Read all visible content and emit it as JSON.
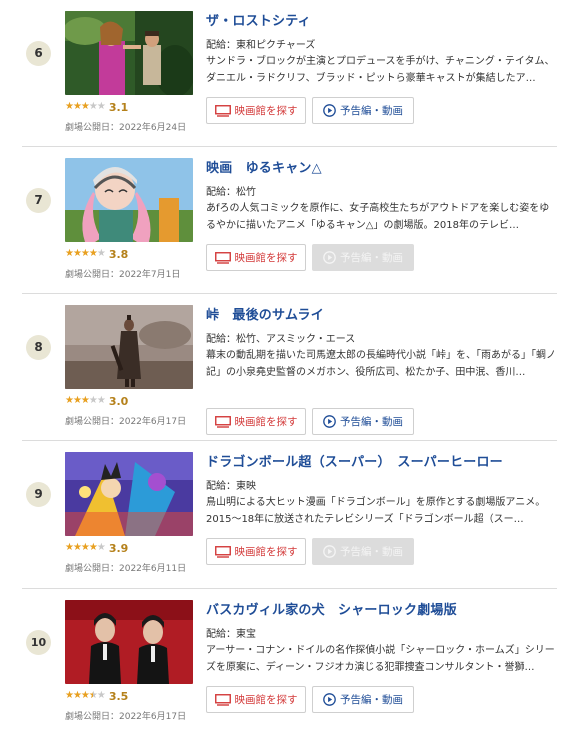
{
  "buttons": {
    "theater_label": "映画館を探す",
    "trailer_label": "予告編・動画"
  },
  "colors": {
    "title": "#1f4d97",
    "theater_button_text": "#d33a3a",
    "star_filled": "#e8a020",
    "rank_badge": "#e9e6d4"
  },
  "movies": [
    {
      "rank": "6",
      "title": "ザ・ロストシティ",
      "distributor": "配給：東和ピクチャーズ",
      "description": "サンドラ・ブロックが主演とプロデュースを手がけ、チャニング・テイタム、ダニエル・ラドクリフ、ブラッド・ピットら豪華キャストが集結したア…",
      "rating": "3.1",
      "stars": 3,
      "release": "劇場公開日：2022年6月24日",
      "trailer_available": true
    },
    {
      "rank": "7",
      "title": "映画　ゆるキャン△",
      "distributor": "配給：松竹",
      "description": "あfろの人気コミックを原作に、女子高校生たちがアウトドアを楽しむ姿をゆるやかに描いたアニメ「ゆるキャン△」の劇場版。2018年のテレビ…",
      "rating": "3.8",
      "stars": 4,
      "release": "劇場公開日：2022年7月1日",
      "trailer_available": false
    },
    {
      "rank": "8",
      "title": "峠　最後のサムライ",
      "distributor": "配給：松竹、アスミック・エース",
      "description": "幕末の動乱期を描いた司馬遼太郎の長編時代小説「峠」を、「雨あがる」「蜩ノ記」の小泉堯史監督のメガホン、役所広司、松たか子、田中泯、香川…",
      "rating": "3.0",
      "stars": 3,
      "release": "劇場公開日：2022年6月17日",
      "trailer_available": true
    },
    {
      "rank": "9",
      "title": "ドラゴンボール超（スーパー）　スーパーヒーロー",
      "distributor": "配給：東映",
      "description": "鳥山明による大ヒット漫画「ドラゴンボール」を原作とする劇場版アニメ。2015～18年に放送されたテレビシリーズ「ドラゴンボール超（スー…",
      "rating": "3.9",
      "stars": 4,
      "release": "劇場公開日：2022年6月11日",
      "trailer_available": false
    },
    {
      "rank": "10",
      "title": "バスカヴィル家の犬　シャーロック劇場版",
      "distributor": "配給：東宝",
      "description": "アーサー・コナン・ドイルの名作探偵小説「シャーロック・ホームズ」シリーズを原案に、ディーン・フジオカ演じる犯罪捜査コンサルタント・誉獅…",
      "rating": "3.5",
      "stars": 3.5,
      "release": "劇場公開日：2022年6月17日",
      "trailer_available": true
    }
  ]
}
